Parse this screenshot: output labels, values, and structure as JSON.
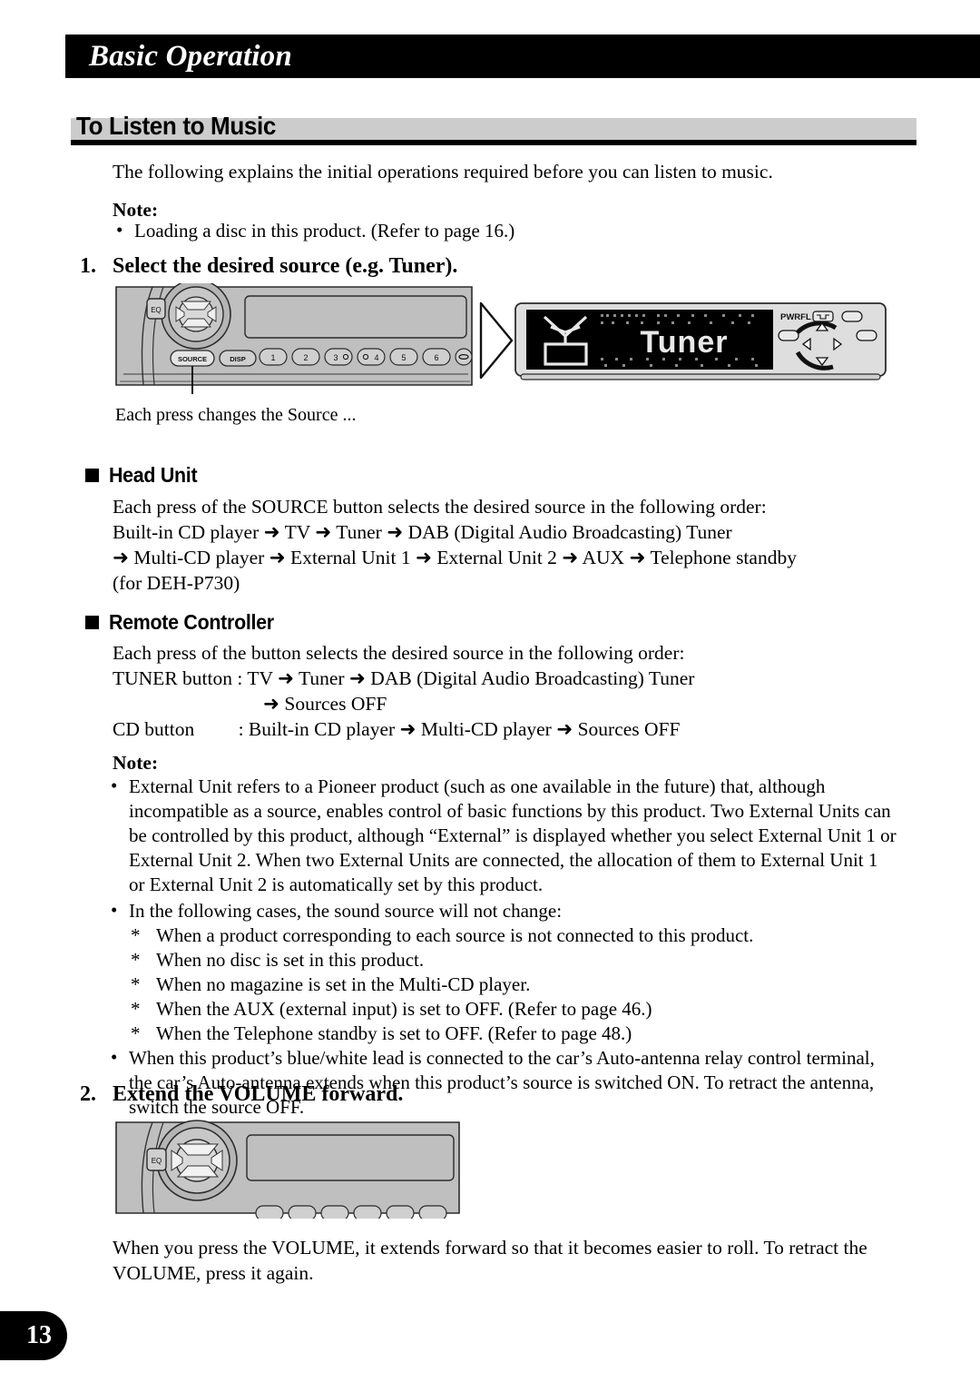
{
  "chapter": {
    "title": "Basic Operation"
  },
  "section": {
    "title": "To Listen to Music"
  },
  "intro": "The following explains the initial operations required before you can listen to music.",
  "note_top": {
    "label": "Note:",
    "items": [
      "Loading a disc in this product. (Refer to page 16.)"
    ]
  },
  "step1": {
    "number": "1.",
    "text": "Select the desired source (e.g. Tuner)."
  },
  "figure1": {
    "head_unit": {
      "eq_label": "EQ",
      "source_label": "SOURCE",
      "disp_label": "DISP",
      "preset_buttons": [
        "1",
        "2",
        "3",
        "4",
        "5",
        "6"
      ]
    },
    "display_panel": {
      "screen_text": "Tuner",
      "pwrfl_label": "PWRFL"
    },
    "caption": "Each press changes the Source ..."
  },
  "head_unit_section": {
    "heading": "Head Unit",
    "lines": [
      "Each press of the SOURCE button selects the desired source in the following order:",
      "Built-in CD player ➜ TV ➜ Tuner ➜ DAB (Digital Audio Broadcasting) Tuner",
      "➜ Multi-CD player ➜ External Unit 1 ➜ External Unit 2 ➜ AUX ➜ Telephone standby",
      "(for DEH-P730)"
    ]
  },
  "remote_section": {
    "heading": "Remote Controller",
    "lines": [
      "Each press of the button selects the desired source in the following order:",
      "TUNER button  : TV ➜ Tuner ➜ DAB (Digital Audio Broadcasting) Tuner",
      "➜ Sources OFF",
      "CD button         : Built-in CD player ➜ Multi-CD player ➜ Sources OFF"
    ]
  },
  "note_main": {
    "label": "Note:",
    "bullet1": "External Unit refers to a Pioneer product (such as one available in the future) that, although incompatible as a source, enables control of basic functions by this product. Two External Units can be controlled by this product, although “External” is displayed whether you select External Unit 1 or External Unit 2. When two External Units are connected, the allocation of them to External Unit 1 or External Unit 2 is automatically set by this product.",
    "bullet2": "In the following cases, the sound source will not change:",
    "sub_items": [
      "When a product corresponding to each source is not connected to this product.",
      "When no disc is set in this product.",
      "When no magazine is set in the Multi-CD player.",
      "When the AUX (external input) is set to OFF. (Refer to page 46.)",
      "When the Telephone standby is set to OFF. (Refer to page 48.)"
    ],
    "bullet3": "When this product’s blue/white lead is connected to the car’s Auto-antenna relay control terminal, the car’s Auto-antenna extends when this product’s source is switched ON. To retract the antenna, switch the source OFF."
  },
  "step2": {
    "number": "2.",
    "text": "Extend the VOLUME forward."
  },
  "figure2": {
    "eq_label": "EQ"
  },
  "closing": "When you press the VOLUME, it extends forward so that it becomes easier to roll. To retract the VOLUME, press it again.",
  "page_number": "13"
}
